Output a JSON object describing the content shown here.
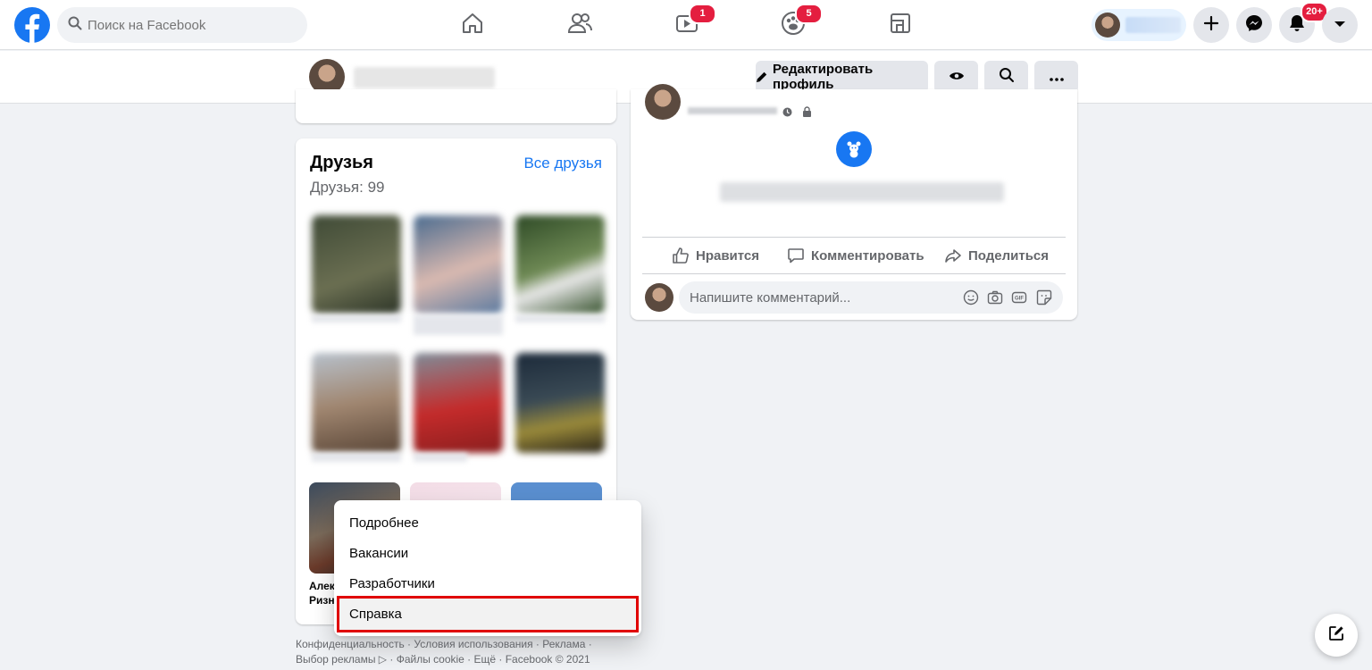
{
  "search": {
    "placeholder": "Поиск на Facebook"
  },
  "nav": {
    "watch_badge": "1",
    "groups_badge": "5",
    "notifications_badge": "20+"
  },
  "profile_bar": {
    "edit_profile_label": "Редактировать профиль"
  },
  "friends": {
    "title": "Друзья",
    "count_label": "Друзья: 99",
    "all_link": "Все друзья",
    "partial_name_1": "Алек",
    "partial_name_2": "Ризн"
  },
  "post": {
    "like_label": "Нравится",
    "comment_label": "Комментировать",
    "share_label": "Поделиться",
    "comment_placeholder": "Напишите комментарий..."
  },
  "menu": {
    "items": [
      {
        "label": "Подробнее"
      },
      {
        "label": "Вакансии"
      },
      {
        "label": "Разработчики"
      },
      {
        "label": "Справка",
        "highlighted": true
      }
    ]
  },
  "footer": {
    "line1": "Конфиденциальность · Условия использования · Реклама ·",
    "line2": "Выбор рекламы ▷ · Файлы cookie · Ещё · Facebook © 2021"
  },
  "colors": {
    "brand": "#1877f2",
    "badge": "#e41e3f",
    "highlight_border": "#e00000"
  }
}
